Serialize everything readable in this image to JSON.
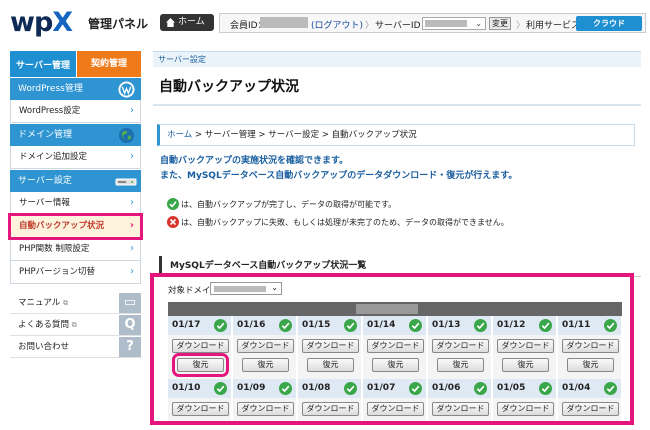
{
  "header": {
    "logo_main": "wp",
    "logo_x": "X",
    "subtitle": "管理パネル",
    "home_label": "ホーム",
    "member_label": "会員ID：",
    "logout_label": "(ログアウト)",
    "separator": "〉",
    "server_id_label": "サーバーID：",
    "change_label": "変更",
    "service_label": "利用サービス：",
    "service_value": "クラウド"
  },
  "sidebar": {
    "tabs": [
      {
        "label": "サーバー管理"
      },
      {
        "label": "契約管理"
      }
    ],
    "sections": [
      {
        "head": "WordPress管理",
        "items": [
          {
            "label": "WordPress設定"
          }
        ]
      },
      {
        "head": "ドメイン管理",
        "items": [
          {
            "label": "ドメイン追加設定"
          }
        ]
      },
      {
        "head": "サーバー設定",
        "items": [
          {
            "label": "サーバー情報"
          },
          {
            "label": "自動バックアップ状況"
          },
          {
            "label": "PHP関数 制限設定"
          },
          {
            "label": "PHPバージョン切替"
          }
        ]
      }
    ],
    "chevron": "›",
    "links": [
      {
        "label": "マニュアル",
        "glyph": "▭"
      },
      {
        "label": "よくある質問",
        "glyph": "Q"
      },
      {
        "label": "お問い合わせ",
        "glyph": "?"
      }
    ],
    "link_ext": "⧉"
  },
  "main": {
    "band_label": "サーバー設定",
    "title": "自動バックアップ状況",
    "breadcrumb": {
      "home": "ホーム",
      "rest": " > サーバー管理 > サーバー設定 > 自動バックアップ状況"
    },
    "desc1": "自動バックアップの実施状況を確認できます。",
    "desc2": "また、MySQLデータベース自動バックアップのデータダウンロード・復元が行えます。",
    "note_ok": "は、自動バックアップが完了し、データの取得が可能です。",
    "note_ng": "は、自動バックアップに失敗、もしくは処理が未完了のため、データの取得ができません。",
    "section_title": "MySQLデータベース自動バックアップ状況一覧",
    "domain_label": "対象ドメイン："
  },
  "backup": {
    "download_label": "ダウンロード",
    "restore_label": "復元",
    "rows": [
      [
        "01/17",
        "01/16",
        "01/15",
        "01/14",
        "01/13",
        "01/12",
        "01/11"
      ],
      [
        "01/10",
        "01/09",
        "01/08",
        "01/07",
        "01/06",
        "01/05",
        "01/04"
      ]
    ]
  },
  "colors": {
    "highlight": "#e5157e",
    "accent_blue": "#2f95d2",
    "accent_orange": "#ef7a1a",
    "ok_green": "#3aa64a",
    "ng_red": "#d9342b"
  }
}
